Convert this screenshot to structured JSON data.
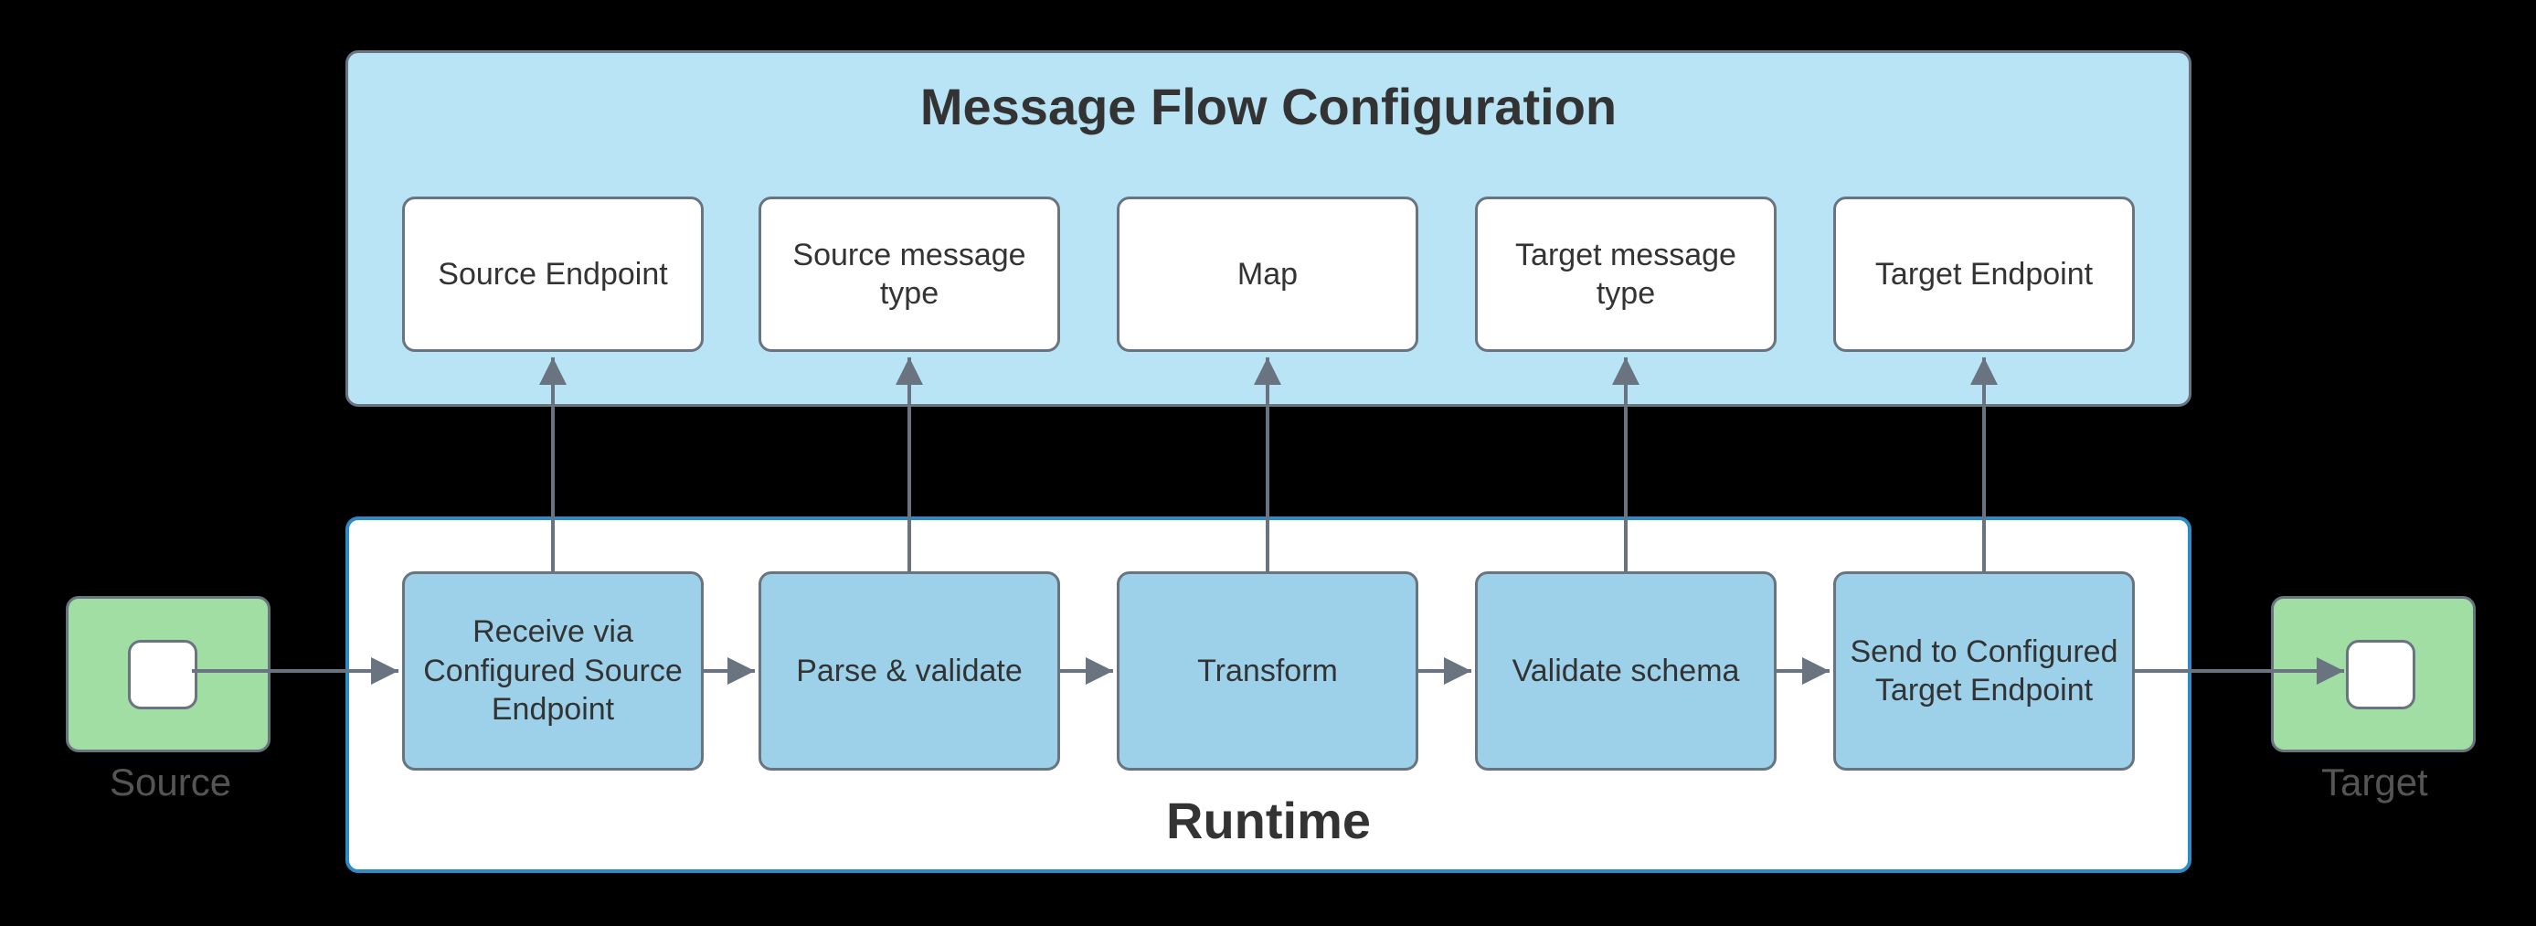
{
  "diagram": {
    "config": {
      "title": "Message Flow Configuration",
      "nodes": [
        {
          "id": "src-endpoint",
          "label": "Source Endpoint"
        },
        {
          "id": "src-msg-type",
          "label": "Source message type"
        },
        {
          "id": "map",
          "label": "Map"
        },
        {
          "id": "tgt-msg-type",
          "label": "Target message type"
        },
        {
          "id": "tgt-endpoint",
          "label": "Target Endpoint"
        }
      ]
    },
    "runtime": {
      "title": "Runtime",
      "nodes": [
        {
          "id": "receive",
          "label": "Receive via Configured Source Endpoint"
        },
        {
          "id": "parse",
          "label": "Parse & validate"
        },
        {
          "id": "transform",
          "label": "Transform"
        },
        {
          "id": "validate",
          "label": "Validate schema"
        },
        {
          "id": "send",
          "label": "Send to Configured Target Endpoint"
        }
      ]
    },
    "external": {
      "source": {
        "label": "Source"
      },
      "target": {
        "label": "Target"
      }
    },
    "edges": {
      "horizontal": [
        [
          "source-node",
          "receive"
        ],
        [
          "receive",
          "parse"
        ],
        [
          "parse",
          "transform"
        ],
        [
          "transform",
          "validate"
        ],
        [
          "validate",
          "send"
        ],
        [
          "send",
          "target-node"
        ]
      ],
      "vertical": [
        [
          "receive",
          "src-endpoint"
        ],
        [
          "parse",
          "src-msg-type"
        ],
        [
          "transform",
          "map"
        ],
        [
          "validate",
          "tgt-msg-type"
        ],
        [
          "send",
          "tgt-endpoint"
        ]
      ]
    },
    "colors": {
      "configBg": "#b9e4f5",
      "runtimeBorder": "#2d8cc8",
      "runtimeCell": "#9dd1ea",
      "endpoint": "#a1dea3",
      "stroke": "#6a7480"
    }
  }
}
